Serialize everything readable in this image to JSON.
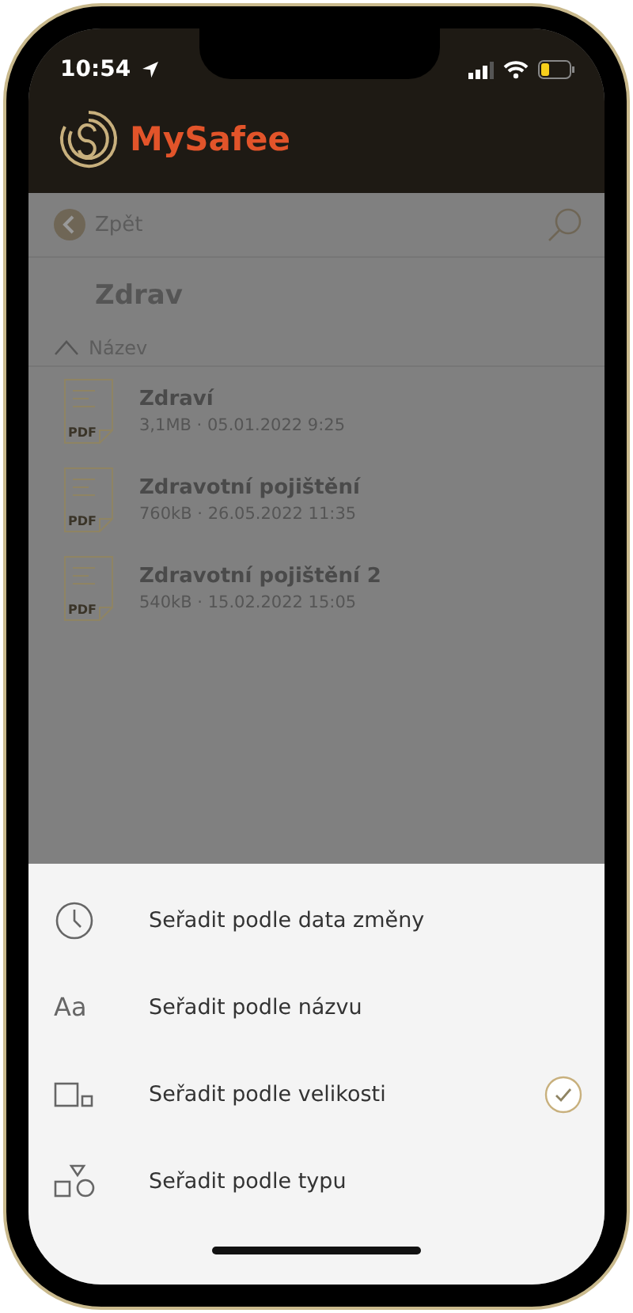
{
  "status_bar": {
    "time": "10:54"
  },
  "header": {
    "app_name": "MySafee"
  },
  "nav": {
    "back": "Zpět"
  },
  "folder": {
    "title": "Zdrav"
  },
  "sort_header": {
    "label": "Název"
  },
  "files": [
    {
      "name": "Zdraví",
      "meta": "3,1MB · 05.01.2022 9:25",
      "type_label": "PDF"
    },
    {
      "name": "Zdravotní pojištění",
      "meta": "760kB · 26.05.2022 11:35",
      "type_label": "PDF"
    },
    {
      "name": "Zdravotní pojištění 2",
      "meta": "540kB · 15.02.2022 15:05",
      "type_label": "PDF"
    }
  ],
  "sort_options": [
    {
      "kind": "clock",
      "label": "Seřadit podle data změny",
      "selected": false
    },
    {
      "kind": "text",
      "icon_text": "Aa",
      "label": "Seřadit podle názvu",
      "selected": false
    },
    {
      "kind": "size",
      "label": "Seřadit podle velikosti",
      "selected": true
    },
    {
      "kind": "type",
      "label": "Seřadit podle typu",
      "selected": false
    }
  ]
}
